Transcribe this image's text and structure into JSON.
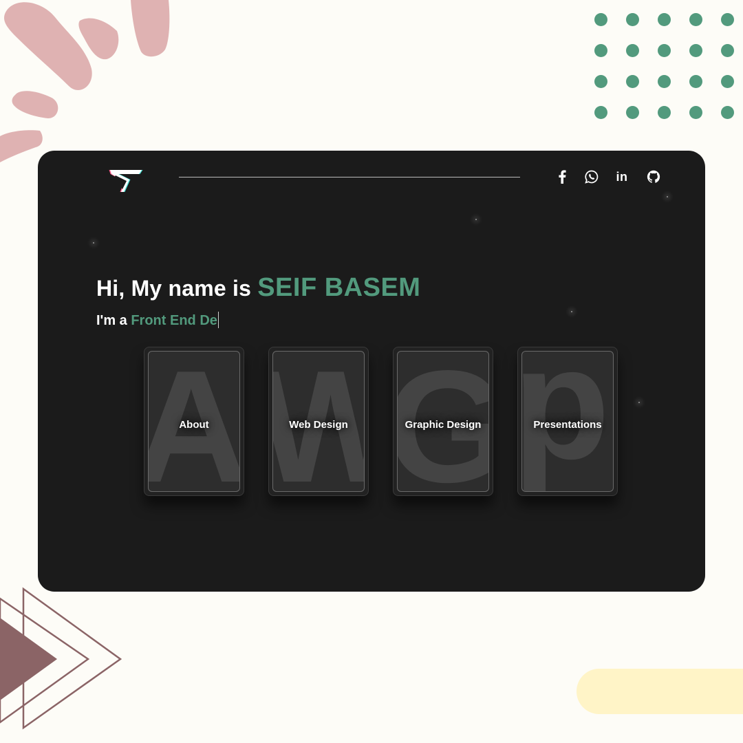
{
  "header": {
    "logo_icon": "s-monogram-logo-icon",
    "social_links": [
      {
        "name": "facebook",
        "icon": "facebook-icon"
      },
      {
        "name": "whatsapp",
        "icon": "whatsapp-icon"
      },
      {
        "name": "linkedin",
        "icon": "linkedin-icon",
        "glyph": "in"
      },
      {
        "name": "github",
        "icon": "github-icon"
      }
    ]
  },
  "hero": {
    "greeting": "Hi, My name is",
    "name": "SEIF BASEM",
    "role_prefix": "I'm a",
    "role_typed": "Front End De"
  },
  "tiles": [
    {
      "label": "About",
      "letter": "A"
    },
    {
      "label": "Web Design",
      "letter": "W"
    },
    {
      "label": "Graphic Design",
      "letter": "G"
    },
    {
      "label": "Presentations",
      "letter": "p"
    }
  ],
  "colors": {
    "accent": "#529a7d",
    "card_background": "#1b1b1b",
    "page_background": "#fdfcf7",
    "pink_decoration": "#dfb2b2",
    "mauve_decoration": "#8b6466",
    "yellow_decoration": "#fff4c7"
  }
}
